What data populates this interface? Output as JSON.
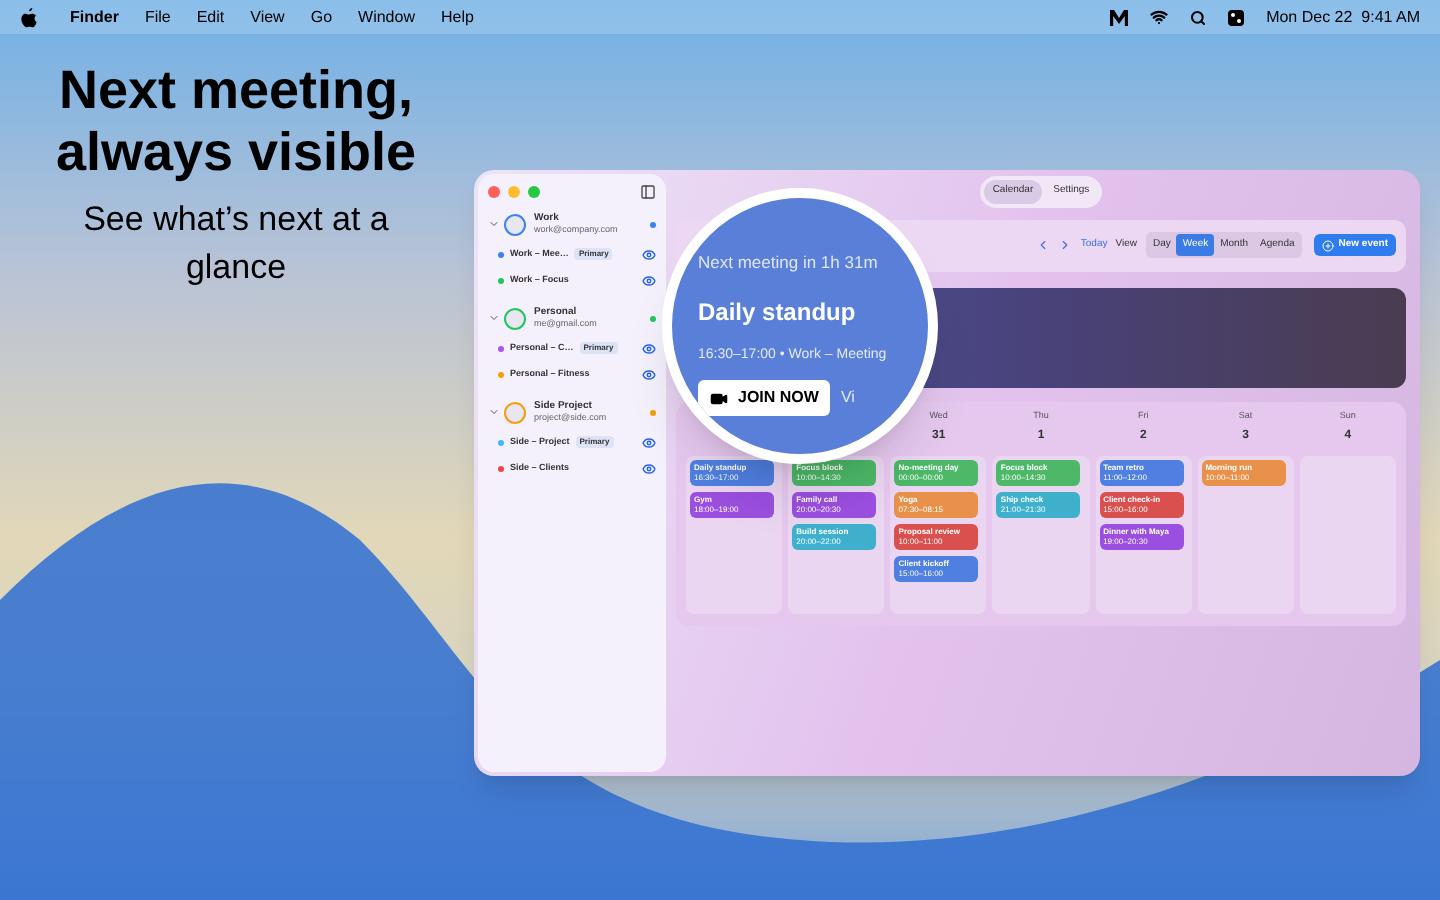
{
  "menu_bar": {
    "items": [
      {
        "label": "Finder",
        "bold": true
      },
      {
        "label": "File",
        "bold": false
      },
      {
        "label": "Edit",
        "bold": false
      },
      {
        "label": "View",
        "bold": false
      },
      {
        "label": "Go",
        "bold": false
      },
      {
        "label": "Window",
        "bold": false
      },
      {
        "label": "Help",
        "bold": false
      }
    ],
    "clock": "Mon Dec 22  9:41 AM"
  },
  "hero": {
    "title": "Next meeting, always visible",
    "subtitle": "See what’s next at a glance"
  },
  "tabs": [
    {
      "label": "Calendar",
      "selected": true
    },
    {
      "label": "Settings",
      "selected": false
    }
  ],
  "sidebar": {
    "accounts": [
      {
        "name": "Work",
        "email": "work@company.com",
        "color": "#3b82f6",
        "expanded": true,
        "calendars": [
          {
            "name": "Work – Mee…",
            "badge": "Primary",
            "color": "#3b82f6",
            "visible": true
          },
          {
            "name": "Work – Focus",
            "color": "#22c55e",
            "visible": true
          }
        ]
      },
      {
        "name": "Personal",
        "email": "me@gmail.com",
        "color": "#22c55e",
        "expanded": true,
        "calendars": [
          {
            "name": "Personal – C…",
            "badge": "Primary",
            "color": "#a855f7",
            "visible": true
          },
          {
            "name": "Personal – Fitness",
            "color": "#f59e0b",
            "visible": true
          }
        ]
      },
      {
        "name": "Side Project",
        "email": "project@side.com",
        "color": "#f59e0b",
        "expanded": true,
        "calendars": [
          {
            "name": "Side – Project",
            "badge": "Primary",
            "color": "#38bdf8",
            "visible": true
          },
          {
            "name": "Side – Clients",
            "color": "#ef4444",
            "visible": true
          }
        ]
      }
    ]
  },
  "toolbar": {
    "today": "Today",
    "view_label": "View",
    "views": [
      {
        "label": "Day",
        "selected": false
      },
      {
        "label": "Week",
        "selected": true
      },
      {
        "label": "Month",
        "selected": false
      },
      {
        "label": "Agenda",
        "selected": false
      }
    ],
    "new_event": "New event"
  },
  "week": {
    "days": [
      {
        "events": [
          {
            "title": "Daily standup",
            "time": "16:30–17:00",
            "color": "#4f7fe0"
          },
          {
            "title": "Gym",
            "time": "18:00–19:00",
            "color": "#9b4fe0"
          }
        ]
      },
      {
        "events": [
          {
            "title": "Focus block",
            "time": "10:00–14:30",
            "color": "#4cb868"
          },
          {
            "title": "Family call",
            "time": "20:00–20:30",
            "color": "#9b4fe0"
          },
          {
            "title": "Build session",
            "time": "20:00–22:00",
            "color": "#3fb0cc"
          }
        ]
      },
      {
        "name": "Wed",
        "date": "31",
        "events": [
          {
            "title": "No-meeting day",
            "time": "00:00–00:00",
            "color": "#4cb868"
          },
          {
            "title": "Yoga",
            "time": "07:30–08:15",
            "color": "#e8914a"
          },
          {
            "title": "Proposal review",
            "time": "10:00–11:00",
            "color": "#d9504f"
          },
          {
            "title": "Client kickoff",
            "time": "15:00–16:00",
            "color": "#4f7fe0"
          }
        ]
      },
      {
        "name": "Thu",
        "date": "1",
        "events": [
          {
            "title": "Focus block",
            "time": "10:00–14:30",
            "color": "#4cb868"
          },
          {
            "title": "Ship check",
            "time": "21:00–21:30",
            "color": "#3fb0cc"
          }
        ]
      },
      {
        "name": "Fri",
        "date": "2",
        "events": [
          {
            "title": "Team retro",
            "time": "11:00–12:00",
            "color": "#4f7fe0"
          },
          {
            "title": "Client check-in",
            "time": "15:00–16:00",
            "color": "#d9504f"
          },
          {
            "title": "Dinner with Maya",
            "time": "19:00–20:30",
            "color": "#9b4fe0"
          }
        ]
      },
      {
        "name": "Sat",
        "date": "3",
        "events": [
          {
            "title": "Morning run",
            "time": "10:00–11:00",
            "color": "#e8914a"
          }
        ]
      },
      {
        "name": "Sun",
        "date": "4"
      }
    ]
  },
  "magnifier": {
    "caption": "Next meeting in 1h 31m",
    "title": "Daily standup",
    "details": "16:30–17:00 • Work – Meeting",
    "join_button": "JOIN NOW",
    "cut_text": "Vi"
  }
}
